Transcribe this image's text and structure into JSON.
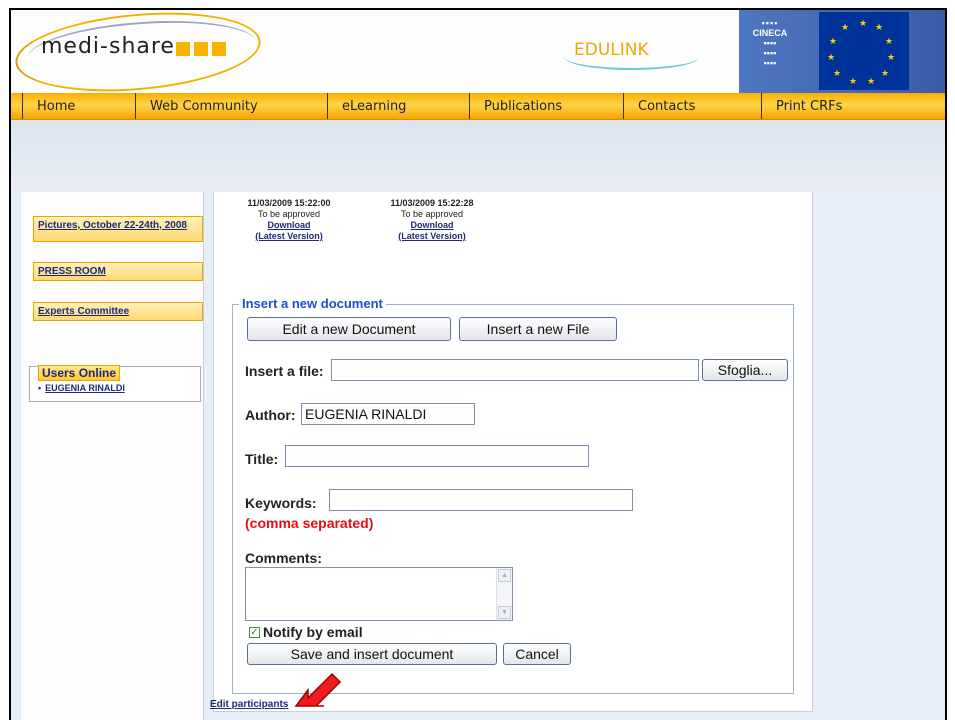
{
  "header": {
    "logo_text": "medi-share",
    "partner1": "EDULINK",
    "partner2": "CINECA"
  },
  "menu": [
    "Home",
    "Web Community",
    "eLearning",
    "Publications",
    "Contacts",
    "Print CRFs"
  ],
  "sidebar": {
    "items": [
      "Pictures, October 22-24th, 2008",
      "PRESS ROOM",
      "Experts Committee"
    ],
    "users_online_title": "Users Online",
    "users": [
      "EUGENIA RINALDI"
    ]
  },
  "documents": [
    {
      "date": "11/03/2009 15:22:00",
      "status": "To be approved",
      "download": "Download",
      "latest": "(Latest Version)"
    },
    {
      "date": "11/03/2009 15:22:28",
      "status": "To be approved",
      "download": "Download",
      "latest": "(Latest Version)"
    }
  ],
  "form": {
    "legend": "Insert a new document",
    "edit_doc_button": "Edit a new Document",
    "insert_file_button": "Insert a new File",
    "file_label": "Insert a file:",
    "browse_button": "Sfoglia...",
    "author_label": "Author:",
    "author_value": "EUGENIA RINALDI",
    "title_label": "Title:",
    "keywords_label": "Keywords:",
    "keywords_note": "(comma separated)",
    "comments_label": "Comments:",
    "notify_label": "Notify by email",
    "save_button": "Save and insert document",
    "cancel_button": "Cancel"
  },
  "footer": {
    "edit_participants": "Edit participants"
  },
  "colors": {
    "menu": "#f9b000",
    "link": "#1c2a7a",
    "legend": "#1a50c8",
    "note": "#e01010"
  }
}
